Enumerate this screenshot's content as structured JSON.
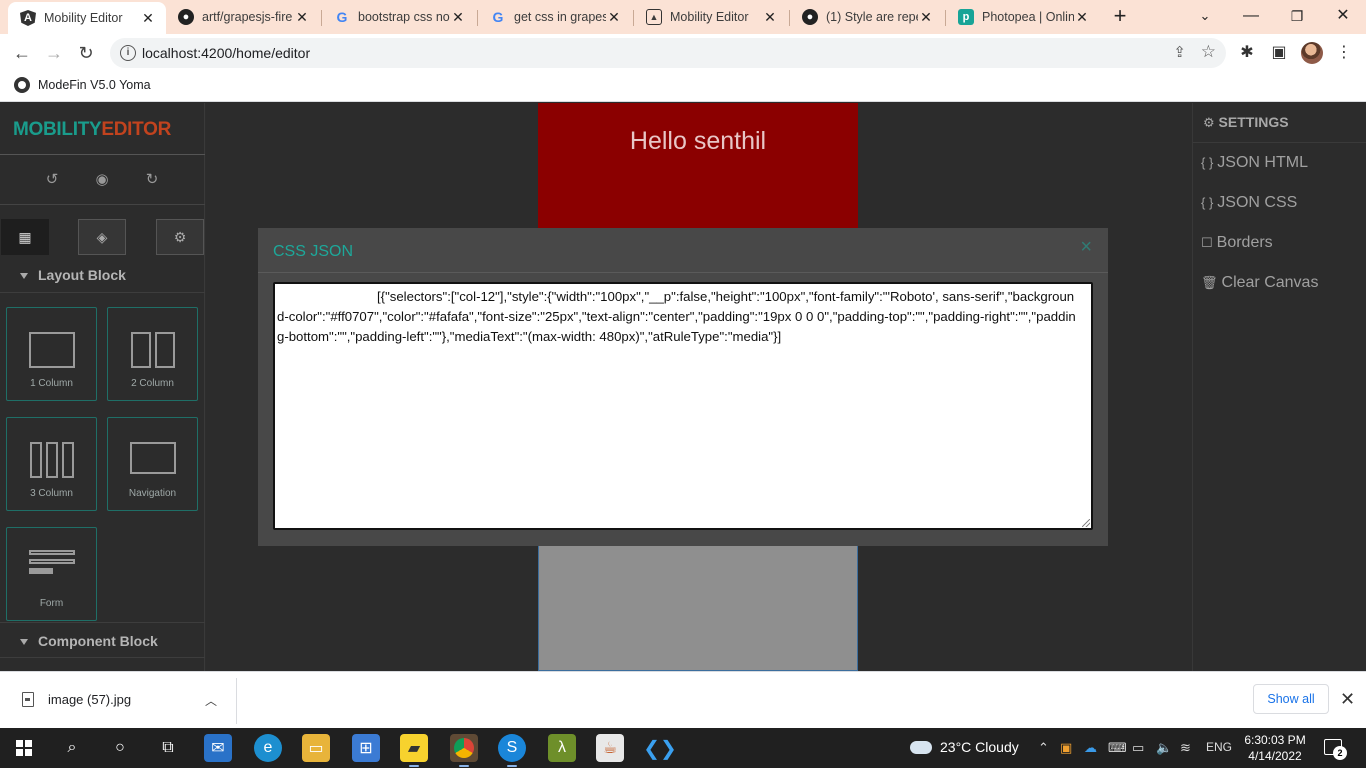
{
  "browser": {
    "tabs": [
      {
        "title": "Mobility Editor",
        "favicon": "angular-icon",
        "active": true
      },
      {
        "title": "artf/grapesjs-fire",
        "favicon": "github-icon"
      },
      {
        "title": "bootstrap css not",
        "favicon": "google-icon"
      },
      {
        "title": "get css in grapes",
        "favicon": "google-icon"
      },
      {
        "title": "Mobility Editor",
        "favicon": "photo-icon"
      },
      {
        "title": "(1) Style are repe",
        "favicon": "github-icon"
      },
      {
        "title": "Photopea | Onlin",
        "favicon": "photopea-icon"
      }
    ],
    "url": "localhost:4200/home/editor",
    "bookmark": "ModeFin V5.0 Yoma"
  },
  "editor": {
    "brand_part1": "MOBILITY",
    "brand_part2": "EDITOR",
    "layout_block_title": "Layout Block",
    "component_block_title": "Component Block",
    "blocks": [
      {
        "label": "1 Column"
      },
      {
        "label": "2 Column"
      },
      {
        "label": "3 Column"
      },
      {
        "label": "Navigation"
      },
      {
        "label": "Form"
      }
    ],
    "canvas_heading": "Hello senthil",
    "settings": {
      "title": "SETTINGS",
      "items": [
        "JSON HTML",
        "JSON CSS",
        "Borders",
        "Clear Canvas"
      ]
    },
    "modal": {
      "title": "CSS JSON",
      "close": "×",
      "content": "[{\"selectors\":[\"col-12\"],\"style\":{\"width\":\"100px\",\"__p\":false,\"height\":\"100px\",\"font-family\":\"'Roboto', sans-serif\",\"background-color\":\"#ff0707\",\"color\":\"#fafafa\",\"font-size\":\"25px\",\"text-align\":\"center\",\"padding\":\"19px 0 0 0\",\"padding-top\":\"\",\"padding-right\":\"\",\"padding-bottom\":\"\",\"padding-left\":\"\"},\"mediaText\":\"(max-width: 480px)\",\"atRuleType\":\"media\"}]"
    }
  },
  "downloads": {
    "file": "image (57).jpg",
    "show_all": "Show all"
  },
  "taskbar": {
    "weather": "23°C  Cloudy",
    "lang": "ENG",
    "time": "6:30:03 PM",
    "date": "4/14/2022",
    "notifications": "2"
  },
  "colors": {
    "brand_teal": "#1a9c8c",
    "brand_orange": "#c2431e",
    "canvas_red": "#8b0000",
    "modal_accent": "#1da89a"
  }
}
